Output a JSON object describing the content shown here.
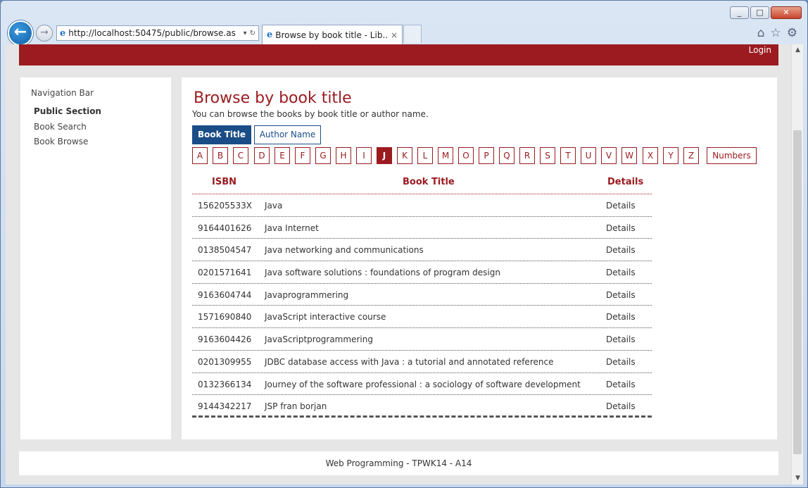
{
  "browser": {
    "url": "http://localhost:50475/public/browse.as",
    "tab_title": "Browse by book title - Lib...",
    "tab_close": "×",
    "back_glyph": "←",
    "forward_glyph": "→",
    "ie_glyph": "e",
    "addr_dropdown": "▾",
    "addr_refresh": "↻",
    "window": {
      "minimize": "_",
      "maximize": "□",
      "close": "✕"
    },
    "icons": {
      "home": "⌂",
      "favorites": "☆",
      "settings": "⚙"
    }
  },
  "header": {
    "login": "Login"
  },
  "sidebar": {
    "title": "Navigation Bar",
    "section": "Public Section",
    "links": [
      "Book Search",
      "Book Browse"
    ]
  },
  "main": {
    "title": "Browse by book title",
    "subtitle": "You can browse the books by book title or author name.",
    "tabs": {
      "active": "Book Title",
      "inactive": "Author Name"
    },
    "letters": [
      "A",
      "B",
      "C",
      "D",
      "E",
      "F",
      "G",
      "H",
      "I",
      "J",
      "K",
      "L",
      "M",
      "O",
      "P",
      "Q",
      "R",
      "S",
      "T",
      "U",
      "V",
      "W",
      "X",
      "Y",
      "Z"
    ],
    "selected_letter": "J",
    "numbers_label": "Numbers",
    "table": {
      "headers": {
        "isbn": "ISBN",
        "title": "Book Title",
        "details": "Details"
      },
      "rows": [
        {
          "isbn": "156205533X",
          "title": "Java",
          "details": "Details"
        },
        {
          "isbn": "9164401626",
          "title": "Java Internet",
          "details": "Details"
        },
        {
          "isbn": "0138504547",
          "title": "Java networking and communications",
          "details": "Details"
        },
        {
          "isbn": "0201571641",
          "title": "Java software solutions : foundations of program design",
          "details": "Details"
        },
        {
          "isbn": "9163604744",
          "title": "Javaprogrammering",
          "details": "Details"
        },
        {
          "isbn": "1571690840",
          "title": "JavaScript interactive course",
          "details": "Details"
        },
        {
          "isbn": "9163604426",
          "title": "JavaScriptprogrammering",
          "details": "Details"
        },
        {
          "isbn": "0201309955",
          "title": "JDBC database access with Java : a tutorial and annotated reference",
          "details": "Details"
        },
        {
          "isbn": "0132366134",
          "title": "Journey of the software professional : a sociology of software development",
          "details": "Details"
        },
        {
          "isbn": "9144342217",
          "title": "JSP fran borjan",
          "details": "Details"
        }
      ]
    }
  },
  "footer": {
    "text": "Web Programming - TPWK14 - A14"
  },
  "colors": {
    "brand": "#9b1b20",
    "tab_blue": "#1a4c87",
    "page_bg": "#e6e6e6"
  }
}
